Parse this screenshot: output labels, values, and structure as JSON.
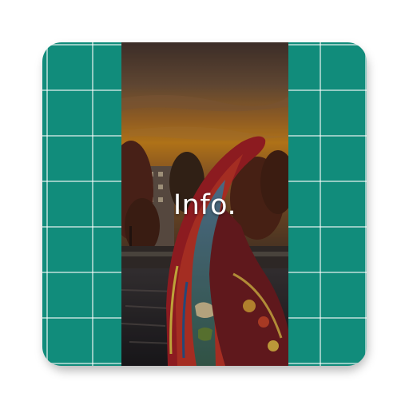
{
  "app_icon": {
    "overlay_text": "Info.",
    "colors": {
      "tile_background": "#118c7b",
      "grid_lines": "#ffffff",
      "sky_top": "#5a4438",
      "sky_glow": "#e08a1e",
      "boat_hull": "#c0282a",
      "water": "#2c2a2e"
    },
    "photo_subject": "sunset-canal-with-painted-boat"
  }
}
